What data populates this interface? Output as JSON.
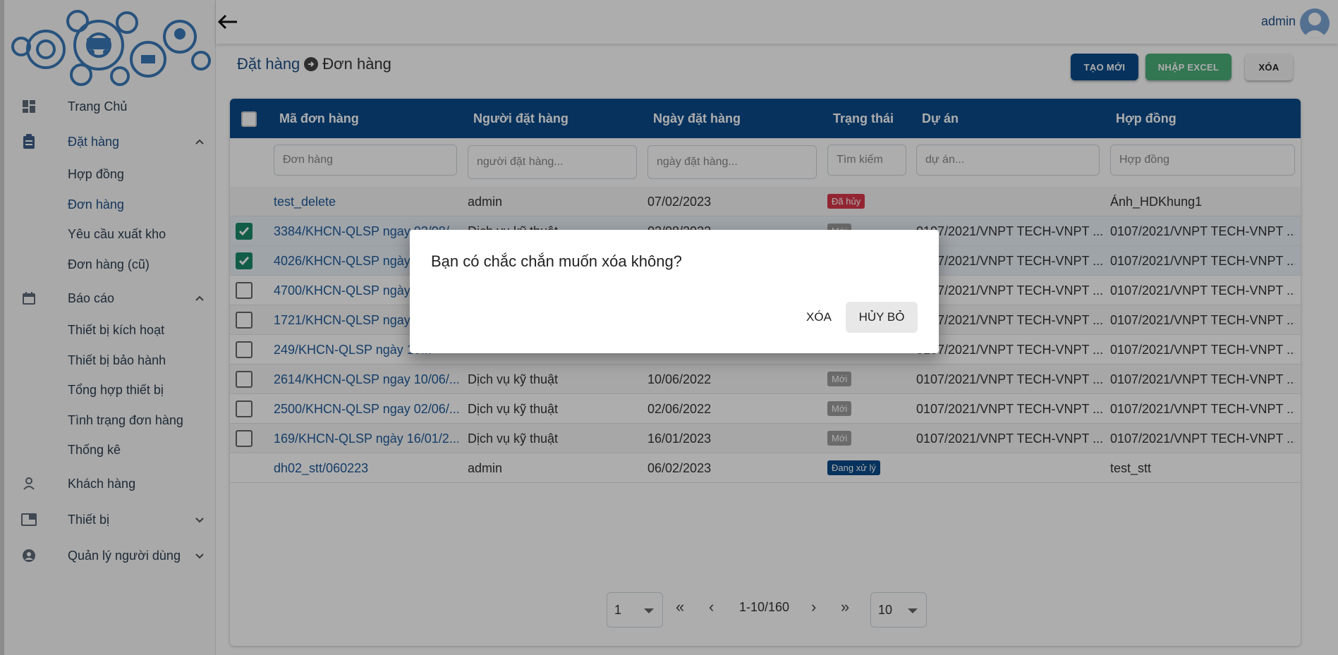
{
  "header": {
    "user_name": "admin"
  },
  "sidebar": {
    "items": [
      {
        "label": "Trang Chủ",
        "icon": "dashboard-icon"
      },
      {
        "label": "Đặt hàng",
        "icon": "clipboard-icon",
        "expanded": true,
        "children": [
          "Hợp đồng",
          "Đơn hàng",
          "Yêu cầu xuất kho",
          "Đơn hàng (cũ)"
        ]
      },
      {
        "label": "Báo cáo",
        "icon": "calendar-icon",
        "expanded": true,
        "children": [
          "Thiết bị kích hoạt",
          "Thiết bị bảo hành",
          "Tổng hợp thiết bị",
          "Tình trạng đơn hàng",
          "Thống kê"
        ]
      },
      {
        "label": "Khách hàng",
        "icon": "person-icon"
      },
      {
        "label": "Thiết bị",
        "icon": "device-icon",
        "expanded": false
      },
      {
        "label": "Quản lý người dùng",
        "icon": "user-circle-icon",
        "expanded": false
      }
    ],
    "active_child": "Đơn hàng"
  },
  "breadcrumb": {
    "parent": "Đặt hàng",
    "current": "Đơn hàng"
  },
  "toolbar": {
    "create_label": "TẠO MỚI",
    "import_label": "NHẬP EXCEL",
    "delete_label": "XÓA"
  },
  "table": {
    "columns": [
      "Mã đơn hàng",
      "Người đặt hàng",
      "Ngày đặt hàng",
      "Trạng thái",
      "Dự án",
      "Hợp đồng"
    ],
    "filters": {
      "code": "Đơn hàng",
      "orderer": "người đặt hàng...",
      "date": "ngày đặt hàng...",
      "status": "Tìm kiếm",
      "project": "dự án...",
      "contract": "Hợp đồng"
    },
    "rows": [
      {
        "checked": null,
        "code": "test_delete",
        "orderer": "admin",
        "date": "07/02/2023",
        "status": "Đã hủy",
        "status_color": "red",
        "project": "",
        "contract": "Ánh_HDKhung1"
      },
      {
        "checked": true,
        "code": "3384/KHCN-QLSP ngay 02/08/...",
        "orderer": "Dịch vụ kỹ thuật",
        "date": "02/08/2022",
        "status": "Mới",
        "status_color": "grey",
        "project": "0107/2021/VNPT TECH-VNPT ...",
        "contract": "0107/2021/VNPT TECH-VNPT ..."
      },
      {
        "checked": true,
        "code": "4026/KHCN-QLSP ngày 2...",
        "orderer": "",
        "date": "",
        "status": "",
        "status_color": "grey",
        "project": "0107/2021/VNPT TECH-VNPT ...",
        "contract": "0107/2021/VNPT TECH-VNPT ..."
      },
      {
        "checked": false,
        "code": "4700/KHCN-QLSP ngày 1...",
        "orderer": "",
        "date": "",
        "status": "",
        "status_color": "grey",
        "project": "0107/2021/VNPT TECH-VNPT ...",
        "contract": "0107/2021/VNPT TECH-VNPT ..."
      },
      {
        "checked": false,
        "code": "1721/KHCN-QLSP ngay 1...",
        "orderer": "",
        "date": "",
        "status": "",
        "status_color": "grey",
        "project": "0107/2021/VNPT TECH-VNPT ...",
        "contract": "0107/2021/VNPT TECH-VNPT ..."
      },
      {
        "checked": false,
        "code": "249/KHCN-QLSP ngày 19...",
        "orderer": "",
        "date": "",
        "status": "",
        "status_color": "grey",
        "project": "0107/2021/VNPT TECH-VNPT ...",
        "contract": "0107/2021/VNPT TECH-VNPT ..."
      },
      {
        "checked": false,
        "code": "2614/KHCN-QLSP ngay 10/06/...",
        "orderer": "Dịch vụ kỹ thuật",
        "date": "10/06/2022",
        "status": "Mới",
        "status_color": "grey",
        "project": "0107/2021/VNPT TECH-VNPT ...",
        "contract": "0107/2021/VNPT TECH-VNPT ..."
      },
      {
        "checked": false,
        "code": "2500/KHCN-QLSP ngay 02/06/...",
        "orderer": "Dịch vụ kỹ thuật",
        "date": "02/06/2022",
        "status": "Mới",
        "status_color": "grey",
        "project": "0107/2021/VNPT TECH-VNPT ...",
        "contract": "0107/2021/VNPT TECH-VNPT ..."
      },
      {
        "checked": false,
        "code": "169/KHCN-QLSP ngày 16/01/2...",
        "orderer": "Dịch vụ kỹ thuật",
        "date": "16/01/2023",
        "status": "Mới",
        "status_color": "grey",
        "project": "0107/2021/VNPT TECH-VNPT ...",
        "contract": "0107/2021/VNPT TECH-VNPT ..."
      },
      {
        "checked": null,
        "code": "dh02_stt/060223",
        "orderer": "admin",
        "date": "06/02/2023",
        "status": "Đang xử lý",
        "status_color": "blue",
        "project": "",
        "contract": "test_stt"
      }
    ]
  },
  "pagination": {
    "page": "1",
    "range": "1-10/160",
    "page_size": "10"
  },
  "dialog": {
    "message": "Bạn có chắc chắn muốn xóa không?",
    "confirm_label": "XÓA",
    "cancel_label": "HỦY BỎ"
  }
}
